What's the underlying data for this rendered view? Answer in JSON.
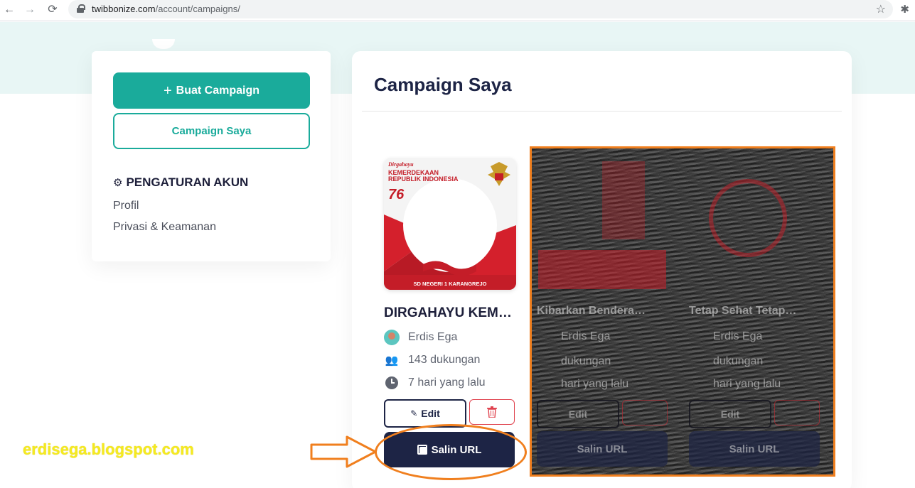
{
  "browser": {
    "url_domain": "twibbonize.com",
    "url_path": "/account/campaigns/"
  },
  "sidebar": {
    "create_button": "Buat Campaign",
    "my_campaign_button": "Campaign Saya",
    "settings_heading": "PENGATURAN AKUN",
    "links": [
      "Profil",
      "Privasi & Keamanan"
    ]
  },
  "main": {
    "title": "Campaign Saya",
    "campaigns": [
      {
        "title": "DIRGAHAYU KEM…",
        "author": "Erdis Ega",
        "supports": "143 dukungan",
        "time": "7 hari yang lalu",
        "edit_label": "Edit",
        "copy_label": "Salin URL",
        "thumb": {
          "kicker": "Dirgahayu",
          "line1": "KEMERDEKAAN",
          "line2": "REPUBLIK INDONESIA",
          "number": "76",
          "footer": "SD NEGERI 1 KARANGREJO"
        }
      },
      {
        "title": "Kibarkan Bendera…",
        "author": "Erdis Ega",
        "supports": "dukungan",
        "time": "hari yang lalu",
        "edit_label": "Edit",
        "copy_label": "Salin URL"
      },
      {
        "title": "Tetap Sehat Tetap…",
        "author": "Erdis Ega",
        "supports": "dukungan",
        "time": "hari yang lalu",
        "edit_label": "Edit",
        "copy_label": "Salin URL"
      }
    ]
  },
  "annotation": {
    "watermark": "erdisega.blogspot.com"
  },
  "colors": {
    "teal": "#1aab9b",
    "navy": "#1d2445",
    "danger": "#e0434e",
    "highlight": "#f07f1e",
    "watermark": "#f5ea20"
  }
}
